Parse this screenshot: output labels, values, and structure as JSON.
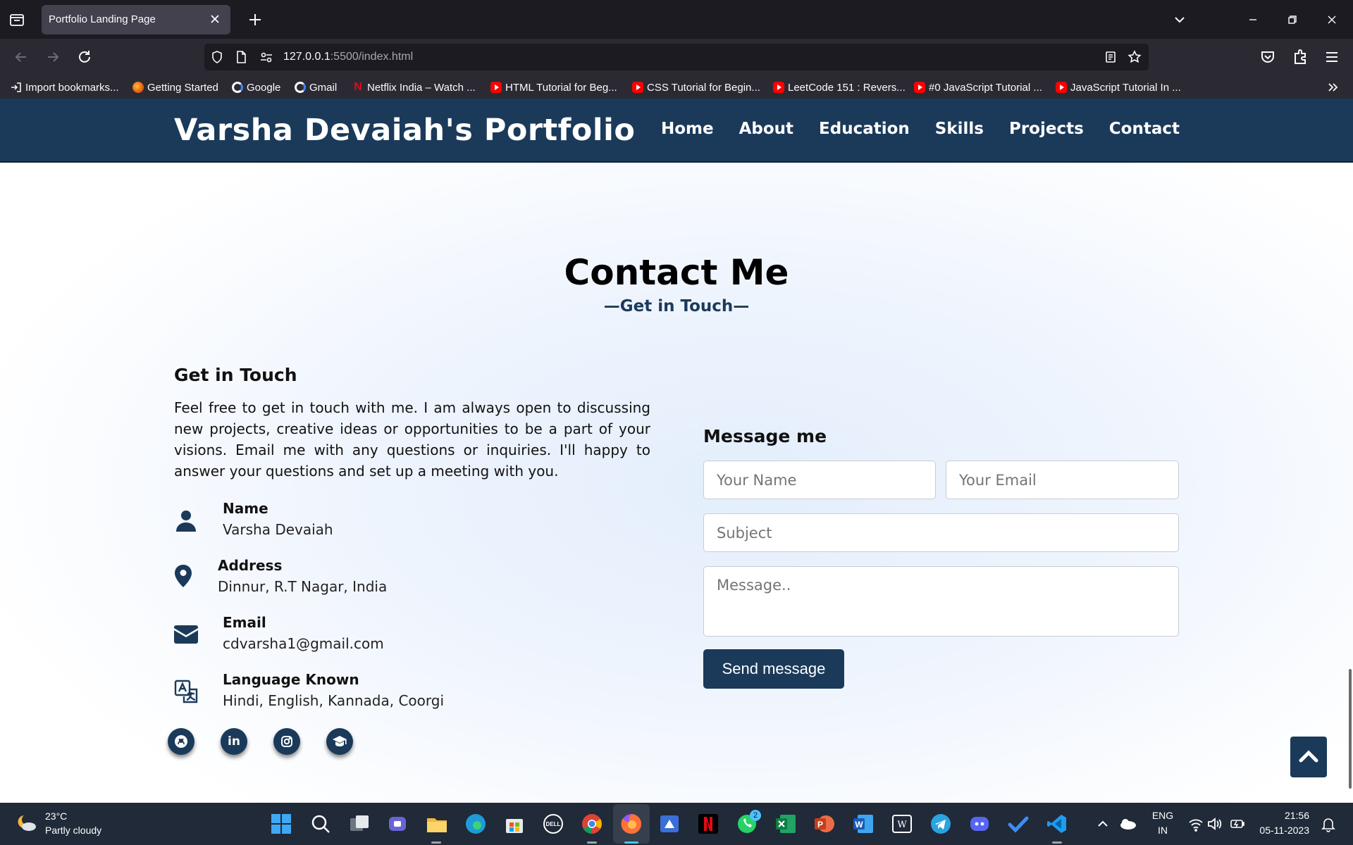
{
  "browser": {
    "tab_title": "Portfolio Landing Page",
    "url_host": "127.0.0.1",
    "url_rest": ":5500/index.html",
    "bookmarks": [
      "Import bookmarks...",
      "Getting Started",
      "Google",
      "Gmail",
      "Netflix India – Watch ...",
      "HTML Tutorial for Beg...",
      "CSS Tutorial for Begin...",
      "LeetCode 151 : Revers...",
      "#0 JavaScript Tutorial ...",
      "JavaScript Tutorial In ..."
    ]
  },
  "site": {
    "brand": "Varsha Devaiah's Portfolio",
    "nav": [
      "Home",
      "About",
      "Education",
      "Skills",
      "Projects",
      "Contact"
    ]
  },
  "contact": {
    "title": "Contact Me",
    "subtitle": "—Get in Touch—",
    "left_heading": "Get in Touch",
    "intro": "Feel free to get in touch with me. I am always open to discussing new projects, creative ideas or opportunities to be a part of your visions. Email me with any questions or inquiries. I'll happy to answer your questions and set up a meeting with you.",
    "details": [
      {
        "label": "Name",
        "value": "Varsha Devaiah",
        "icon": "user-icon"
      },
      {
        "label": "Address",
        "value": "Dinnur, R.T Nagar, India",
        "icon": "map-pin-icon"
      },
      {
        "label": "Email",
        "value": "cdvarsha1@gmail.com",
        "icon": "envelope-icon"
      },
      {
        "label": "Language Known",
        "value": "Hindi, English, Kannada, Coorgi",
        "icon": "translate-icon"
      }
    ],
    "social": [
      "github-icon",
      "linkedin-icon",
      "instagram-icon",
      "graduation-cap-icon"
    ],
    "form": {
      "heading": "Message me",
      "name_placeholder": "Your Name",
      "email_placeholder": "Your Email",
      "subject_placeholder": "Subject",
      "message_placeholder": "Message..",
      "send_label": "Send message"
    }
  },
  "taskbar": {
    "temperature": "23°C",
    "weather": "Partly cloudy",
    "whatsapp_badge": "2",
    "lang_top": "ENG",
    "lang_bottom": "IN",
    "time": "21:56",
    "date": "05-11-2023"
  },
  "colors": {
    "brand_navy": "#1b3a5a",
    "browser_dark": "#1c1b22",
    "taskbar": "#202a38"
  }
}
